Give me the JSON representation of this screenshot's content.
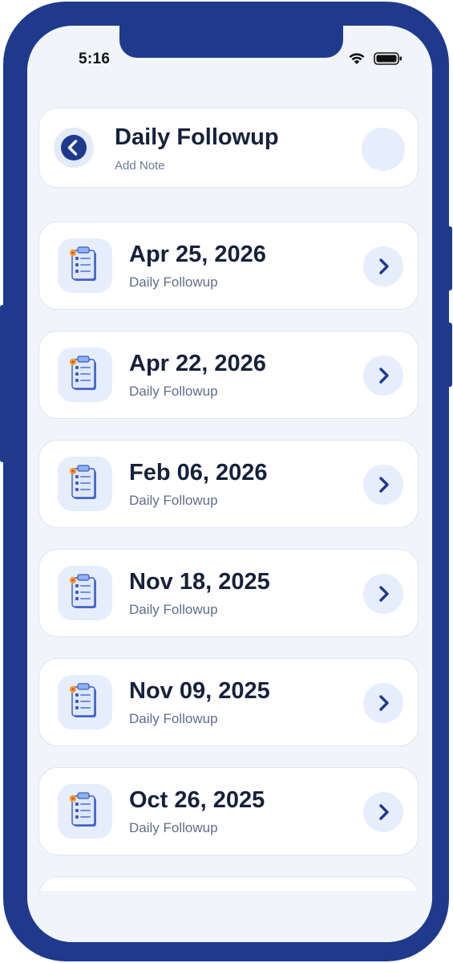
{
  "status_bar": {
    "time": "5:16",
    "wifi_icon": "wifi-icon",
    "battery_icon": "battery-icon"
  },
  "header": {
    "title": "Daily Followup",
    "subtitle": "Add Note",
    "back_icon": "chevron-left-icon"
  },
  "entries": [
    {
      "date": "Apr 25, 2026",
      "label": "Daily Followup"
    },
    {
      "date": "Apr 22, 2026",
      "label": "Daily Followup"
    },
    {
      "date": "Feb 06, 2026",
      "label": "Daily Followup"
    },
    {
      "date": "Nov 18, 2025",
      "label": "Daily Followup"
    },
    {
      "date": "Nov 09, 2025",
      "label": "Daily Followup"
    },
    {
      "date": "Oct 26, 2025",
      "label": "Daily Followup"
    }
  ],
  "colors": {
    "brand": "#1f3a8d",
    "background": "#f1f4f9",
    "card": "#ffffff",
    "accent_soft": "#e6edfb",
    "text_primary": "#16213a",
    "text_secondary": "#5d6e8a"
  }
}
